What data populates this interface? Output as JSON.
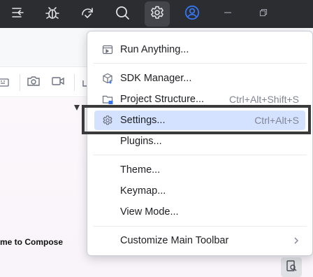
{
  "titlebar": {
    "icons": [
      "run-config-icon",
      "debug-icon",
      "sync-icon",
      "search-icon",
      "gear-icon",
      "account-icon",
      "minimize-icon",
      "restore-icon"
    ]
  },
  "preview": {
    "text": "me to Compose"
  },
  "menu": {
    "items": [
      {
        "label": "Run Anything...",
        "shortcut": "",
        "icon": "run-anything-icon"
      },
      {
        "label": "SDK Manager...",
        "shortcut": "",
        "icon": "sdk-manager-icon"
      },
      {
        "label": "Project Structure...",
        "shortcut": "Ctrl+Alt+Shift+S",
        "icon": "project-structure-icon"
      },
      {
        "label": "Settings...",
        "shortcut": "Ctrl+Alt+S",
        "icon": "settings-gear-icon"
      },
      {
        "label": "Plugins...",
        "shortcut": "",
        "icon": ""
      },
      {
        "label": "Theme...",
        "shortcut": "",
        "icon": ""
      },
      {
        "label": "Keymap...",
        "shortcut": "",
        "icon": ""
      },
      {
        "label": "View Mode...",
        "shortcut": "",
        "icon": ""
      },
      {
        "label": "Customize Main Toolbar",
        "shortcut": "",
        "icon": "",
        "submenu": true
      }
    ],
    "selected_index": 3
  },
  "colors": {
    "titlebar_bg": "#2b2d30",
    "selection": "#d4e2ff",
    "accent_blue": "#3574f0"
  }
}
